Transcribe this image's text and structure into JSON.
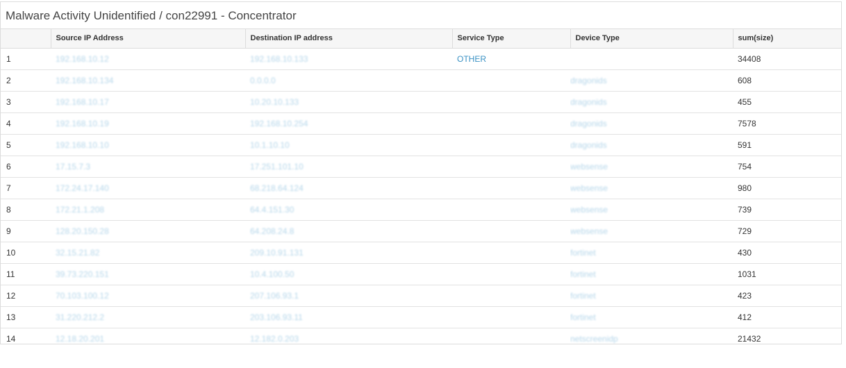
{
  "panel": {
    "title": "Malware Activity Unidentified / con22991 - Concentrator"
  },
  "table": {
    "columns": [
      {
        "key": "idx",
        "label": ""
      },
      {
        "key": "source_ip",
        "label": "Source IP Address"
      },
      {
        "key": "destination_ip",
        "label": "Destination IP address"
      },
      {
        "key": "service_type",
        "label": "Service Type"
      },
      {
        "key": "device_type",
        "label": "Device Type"
      },
      {
        "key": "sum_size",
        "label": "sum(size)"
      }
    ],
    "rows": [
      {
        "idx": "1",
        "source_ip": "192.168.10.12",
        "destination_ip": "192.168.10.133",
        "service_type": "OTHER",
        "device_type": "",
        "sum_size": "34408"
      },
      {
        "idx": "2",
        "source_ip": "192.168.10.134",
        "destination_ip": "0.0.0.0",
        "service_type": "",
        "device_type": "dragonids",
        "sum_size": "608"
      },
      {
        "idx": "3",
        "source_ip": "192.168.10.17",
        "destination_ip": "10.20.10.133",
        "service_type": "",
        "device_type": "dragonids",
        "sum_size": "455"
      },
      {
        "idx": "4",
        "source_ip": "192.168.10.19",
        "destination_ip": "192.168.10.254",
        "service_type": "",
        "device_type": "dragonids",
        "sum_size": "7578"
      },
      {
        "idx": "5",
        "source_ip": "192.168.10.10",
        "destination_ip": "10.1.10.10",
        "service_type": "",
        "device_type": "dragonids",
        "sum_size": "591"
      },
      {
        "idx": "6",
        "source_ip": "17.15.7.3",
        "destination_ip": "17.251.101.10",
        "service_type": "",
        "device_type": "websense",
        "sum_size": "754"
      },
      {
        "idx": "7",
        "source_ip": "172.24.17.140",
        "destination_ip": "68.218.64.124",
        "service_type": "",
        "device_type": "websense",
        "sum_size": "980"
      },
      {
        "idx": "8",
        "source_ip": "172.21.1.208",
        "destination_ip": "64.4.151.30",
        "service_type": "",
        "device_type": "websense",
        "sum_size": "739"
      },
      {
        "idx": "9",
        "source_ip": "128.20.150.28",
        "destination_ip": "64.208.24.8",
        "service_type": "",
        "device_type": "websense",
        "sum_size": "729"
      },
      {
        "idx": "10",
        "source_ip": "32.15.21.82",
        "destination_ip": "209.10.91.131",
        "service_type": "",
        "device_type": "fortinet",
        "sum_size": "430"
      },
      {
        "idx": "11",
        "source_ip": "39.73.220.151",
        "destination_ip": "10.4.100.50",
        "service_type": "",
        "device_type": "fortinet",
        "sum_size": "1031"
      },
      {
        "idx": "12",
        "source_ip": "70.103.100.12",
        "destination_ip": "207.106.93.1",
        "service_type": "",
        "device_type": "fortinet",
        "sum_size": "423"
      },
      {
        "idx": "13",
        "source_ip": "31.220.212.2",
        "destination_ip": "203.106.93.11",
        "service_type": "",
        "device_type": "fortinet",
        "sum_size": "412"
      },
      {
        "idx": "14",
        "source_ip": "12.18.20.201",
        "destination_ip": "12.182.0.203",
        "service_type": "",
        "device_type": "netscreenidp",
        "sum_size": "21432"
      }
    ]
  },
  "colors": {
    "link": "#3a91c4",
    "border": "#dcdcdc",
    "header_bg": "#f6f6f6"
  }
}
